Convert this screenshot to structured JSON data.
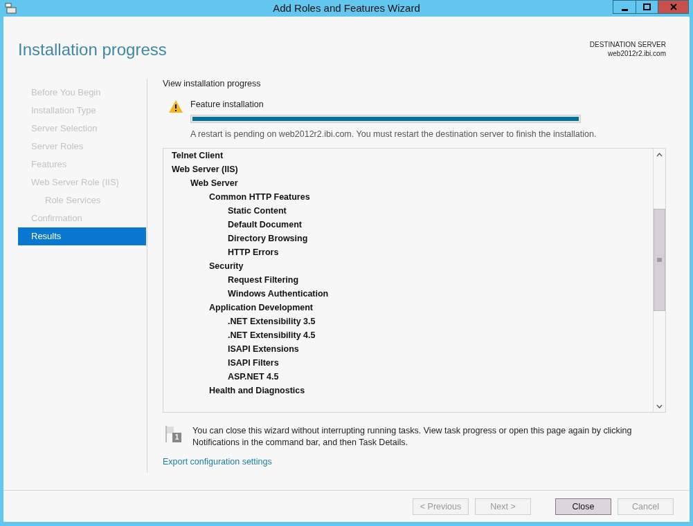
{
  "window": {
    "title": "Add Roles and Features Wizard"
  },
  "page_title": "Installation progress",
  "destination": {
    "label": "DESTINATION SERVER",
    "server": "web2012r2.ibi.com"
  },
  "sidebar": {
    "items": [
      {
        "label": "Before You Begin",
        "selected": false
      },
      {
        "label": "Installation Type",
        "selected": false
      },
      {
        "label": "Server Selection",
        "selected": false
      },
      {
        "label": "Server Roles",
        "selected": false
      },
      {
        "label": "Features",
        "selected": false
      },
      {
        "label": "Web Server Role (IIS)",
        "selected": false,
        "children": [
          {
            "label": "Role Services",
            "selected": false
          }
        ]
      },
      {
        "label": "Confirmation",
        "selected": false
      },
      {
        "label": "Results",
        "selected": true
      }
    ]
  },
  "section_heading": "View installation progress",
  "progress": {
    "label": "Feature installation",
    "level": 1,
    "message": "A restart is pending on web2012r2.ibi.com. You must restart the destination server to finish the installation."
  },
  "results_tree": [
    {
      "label": "Telnet Client"
    },
    {
      "label": "Web Server (IIS)",
      "children": [
        {
          "label": "Web Server",
          "children": [
            {
              "label": "Common HTTP Features",
              "children": [
                {
                  "label": "Static Content"
                },
                {
                  "label": "Default Document"
                },
                {
                  "label": "Directory Browsing"
                },
                {
                  "label": "HTTP Errors"
                }
              ]
            },
            {
              "label": "Security",
              "children": [
                {
                  "label": "Request Filtering"
                },
                {
                  "label": "Windows Authentication"
                }
              ]
            },
            {
              "label": "Application Development",
              "children": [
                {
                  "label": ".NET Extensibility 3.5"
                },
                {
                  "label": ".NET Extensibility 4.5"
                },
                {
                  "label": "ISAPI Extensions"
                },
                {
                  "label": "ISAPI Filters"
                },
                {
                  "label": "ASP.NET 4.5"
                }
              ]
            },
            {
              "label": "Health and Diagnostics"
            }
          ]
        }
      ]
    }
  ],
  "notice": {
    "badge": "1",
    "text": "You can close this wizard without interrupting running tasks. View task progress or open this page again by clicking Notifications in the command bar, and then Task Details."
  },
  "export_link": "Export configuration settings",
  "buttons": [
    {
      "label": "< Previous",
      "disabled": true,
      "default": false
    },
    {
      "label": "Next >",
      "disabled": true,
      "default": false
    },
    {
      "label": "Close",
      "disabled": false,
      "default": true
    },
    {
      "label": "Cancel",
      "disabled": true,
      "default": false
    }
  ]
}
